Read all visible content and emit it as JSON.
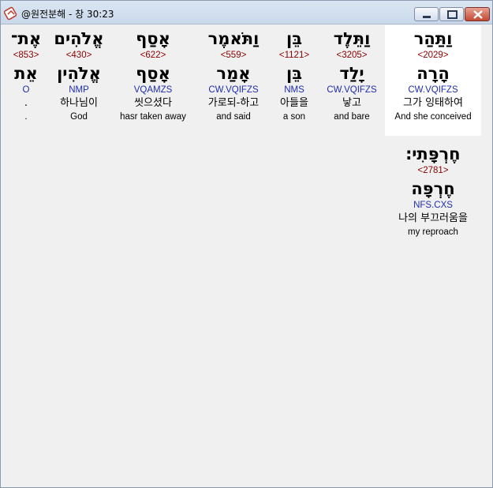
{
  "window": {
    "title": "@원전분해 - 창 30:23",
    "icon": "app-icon"
  },
  "words": [
    {
      "id": "w1",
      "surface": "וַתַּהַר",
      "strongs": "<2029>",
      "lemma": "הָרָה",
      "parse": "CW.VQIFZS",
      "korean": "그가 잉태하여",
      "english": "And she conceived",
      "selected": true
    },
    {
      "id": "w2",
      "surface": "וַתֵּלֶד",
      "strongs": "<3205>",
      "lemma": "יָלַד",
      "parse": "CW.VQIFZS",
      "korean": "낳고",
      "english": "and bare"
    },
    {
      "id": "w3",
      "surface": "בֵּן",
      "strongs": "<1121>",
      "lemma": "בֵּן",
      "parse": "NMS",
      "korean": "아들을",
      "english": "a son"
    },
    {
      "id": "w4",
      "surface": "וַתֹּאמֶר",
      "strongs": "<559>",
      "lemma": "אָמַר",
      "parse": "CW.VQIFZS",
      "korean": "가로되-하고",
      "english": "and said"
    },
    {
      "id": "w5",
      "surface": "אָסַף",
      "strongs": "<622>",
      "lemma": "אָסַף",
      "parse": "VQAMZS",
      "korean": "씻으셨다",
      "english": "hasr taken away"
    },
    {
      "id": "w6",
      "surface": "אֱלֹהִים",
      "strongs": "<430>",
      "lemma": "אֱלֹהִין",
      "parse": "NMP",
      "korean": "하나님이",
      "english": "God"
    },
    {
      "id": "w7",
      "surface": "אֶת־",
      "strongs": "<853>",
      "lemma": "אֵת",
      "parse": "O",
      "korean": ".",
      "english": "."
    },
    {
      "id": "w8",
      "surface": "חֶרְפָּתִי׃",
      "strongs": "<2781>",
      "lemma": "חֶרְפָּה",
      "parse": "NFS.CXS",
      "korean": "나의 부끄러움을",
      "english": "my reproach"
    }
  ]
}
